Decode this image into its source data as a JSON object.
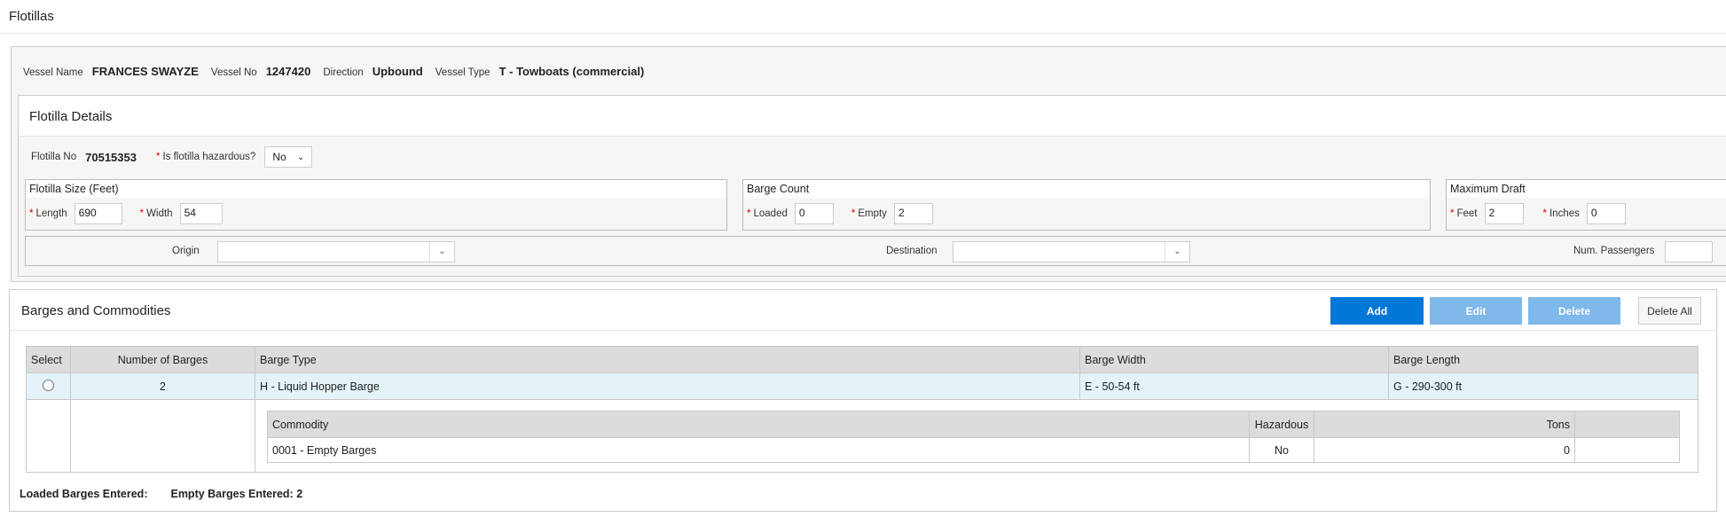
{
  "page": {
    "title": "Flotillas"
  },
  "vessel": {
    "name_label": "Vessel Name",
    "name": "FRANCES SWAYZE",
    "no_label": "Vessel No",
    "no": "1247420",
    "direction_label": "Direction",
    "direction": "Upbound",
    "type_label": "Vessel Type",
    "type": "T - Towboats (commercial)"
  },
  "flotilla": {
    "heading": "Flotilla Details",
    "no_label": "Flotilla No",
    "no": "70515353",
    "hazardous_label": "Is flotilla hazardous?",
    "hazardous": "No",
    "size": {
      "legend": "Flotilla Size (Feet)",
      "length_label": "Length",
      "length": "690",
      "width_label": "Width",
      "width": "54"
    },
    "count": {
      "legend": "Barge Count",
      "loaded_label": "Loaded",
      "loaded": "0",
      "empty_label": "Empty",
      "empty": "2"
    },
    "draft": {
      "legend": "Maximum Draft",
      "feet_label": "Feet",
      "feet": "2",
      "inches_label": "Inches",
      "inches": "0"
    },
    "origin_label": "Origin",
    "origin": "",
    "destination_label": "Destination",
    "destination": "",
    "passengers_label": "Num. Passengers",
    "passengers": ""
  },
  "barges": {
    "heading": "Barges and Commodities",
    "add": "Add",
    "edit": "Edit",
    "delete": "Delete",
    "delete_all": "Delete All",
    "columns": [
      "Select",
      "Number of Barges",
      "Barge Type",
      "Barge Width",
      "Barge Length"
    ],
    "rows": [
      {
        "number": "2",
        "type": "H - Liquid Hopper Barge",
        "width": "E - 50-54 ft",
        "length": "G - 290-300 ft"
      }
    ],
    "commodity_columns": [
      "Commodity",
      "Hazardous",
      "Tons",
      ""
    ],
    "commodities": [
      {
        "commodity": "0001 - Empty Barges",
        "hazardous": "No",
        "tons": "0"
      }
    ],
    "loaded_entered": "Loaded Barges Entered:",
    "empty_entered": "Empty Barges Entered: 2"
  },
  "colors": {
    "primary": "#0078d7",
    "disabled": "#7fb8ea",
    "selected_row": "#e3f3f7"
  }
}
